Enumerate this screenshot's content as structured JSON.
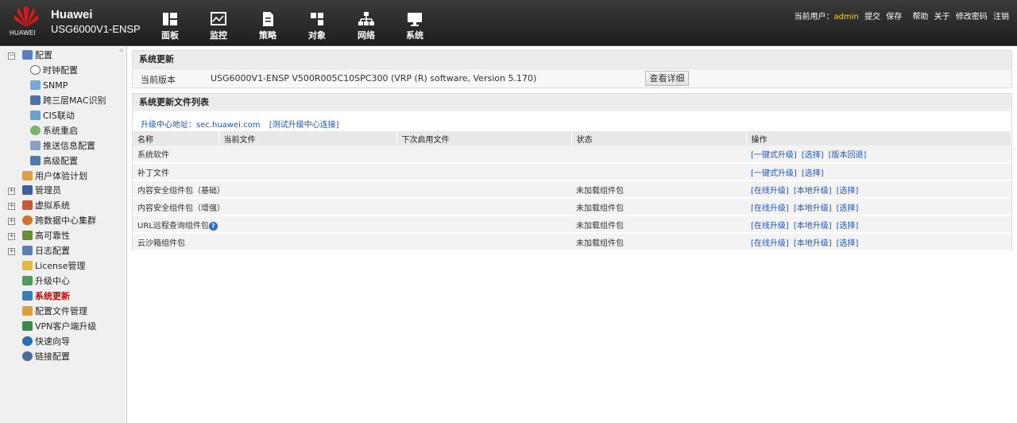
{
  "header": {
    "brand": "HUAWEI",
    "company": "Huawei",
    "product": "USG6000V1-ENSP",
    "nav": [
      {
        "label": "面板",
        "icon": "dashboard-icon"
      },
      {
        "label": "监控",
        "icon": "monitor-icon"
      },
      {
        "label": "策略",
        "icon": "policy-icon"
      },
      {
        "label": "对象",
        "icon": "object-icon"
      },
      {
        "label": "网络",
        "icon": "network-icon"
      },
      {
        "label": "系统",
        "icon": "system-icon"
      }
    ],
    "user_label": "当前用户：",
    "username": "admin",
    "links": [
      "提交",
      "保存",
      "帮助",
      "关于",
      "修改密码",
      "注销"
    ]
  },
  "sidebar": {
    "items": [
      {
        "label": "配置",
        "level": 0,
        "expander": "−"
      },
      {
        "label": "时钟配置",
        "level": 1
      },
      {
        "label": "SNMP",
        "level": 1
      },
      {
        "label": "跨三层MAC识别",
        "level": 1
      },
      {
        "label": "CIS联动",
        "level": 1
      },
      {
        "label": "系统重启",
        "level": 1
      },
      {
        "label": "推送信息配置",
        "level": 1
      },
      {
        "label": "高级配置",
        "level": 1
      },
      {
        "label": "用户体验计划",
        "level": 0
      },
      {
        "label": "管理员",
        "level": 0,
        "expander": "+"
      },
      {
        "label": "虚拟系统",
        "level": 0,
        "expander": "+"
      },
      {
        "label": "跨数据中心集群",
        "level": 0,
        "expander": "+"
      },
      {
        "label": "高可靠性",
        "level": 0,
        "expander": "+"
      },
      {
        "label": "日志配置",
        "level": 0,
        "expander": "+"
      },
      {
        "label": "License管理",
        "level": 0
      },
      {
        "label": "升级中心",
        "level": 0
      },
      {
        "label": "系统更新",
        "level": 0,
        "active": true
      },
      {
        "label": "配置文件管理",
        "level": 0
      },
      {
        "label": "VPN客户端升级",
        "level": 0
      },
      {
        "label": "快速向导",
        "level": 0
      },
      {
        "label": "链接配置",
        "level": 0
      }
    ]
  },
  "update": {
    "title": "系统更新",
    "current_version_label": "当前版本",
    "current_version": "USG6000V1-ENSP V500R005C10SPC300 (VRP (R) software, Version 5.170)",
    "detail_button": "查看详细"
  },
  "file_list": {
    "title": "系统更新文件列表",
    "upgrade_center_label": "升级中心地址：sec.huawei.com",
    "test_link": "[测试升级中心连接]",
    "columns": [
      "名称",
      "当前文件",
      "下次启用文件",
      "状态",
      "操作"
    ],
    "rows": [
      {
        "name": "系统软件",
        "current": "",
        "next": "",
        "status": "",
        "actions": [
          "[一键式升级]",
          "[选择]",
          "[版本回退]"
        ]
      },
      {
        "name": "补丁文件",
        "current": "",
        "next": "",
        "status": "",
        "actions": [
          "[一键式升级]",
          "[选择]"
        ]
      },
      {
        "name": "内容安全组件包（基础）",
        "current": "",
        "next": "",
        "status": "未加载组件包",
        "actions": [
          "[在线升级]",
          "[本地升级]",
          "[选择]"
        ]
      },
      {
        "name": "内容安全组件包（增强）",
        "current": "",
        "next": "",
        "status": "未加载组件包",
        "actions": [
          "[在线升级]",
          "[本地升级]",
          "[选择]"
        ]
      },
      {
        "name": "URL远程查询组件包",
        "current": "",
        "next": "",
        "status": "未加载组件包",
        "actions": [
          "[在线升级]",
          "[本地升级]",
          "[选择]"
        ],
        "help": true
      },
      {
        "name": "云沙箱组件包",
        "current": "",
        "next": "",
        "status": "未加载组件包",
        "actions": [
          "[在线升级]",
          "[本地升级]",
          "[选择]"
        ]
      }
    ]
  },
  "colors": {
    "header_bg": "#2b2b2b",
    "link": "#1a56c0",
    "active_tree": "#cc0000",
    "username": "#ffd700"
  }
}
